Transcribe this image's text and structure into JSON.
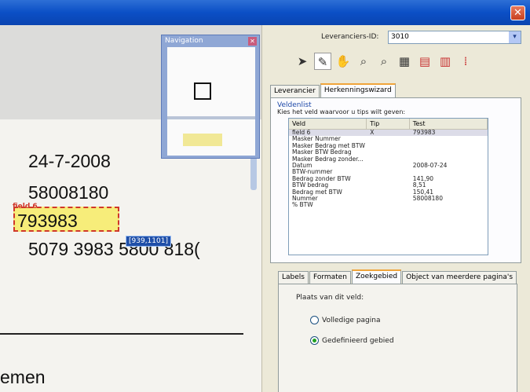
{
  "window": {
    "close_glyph": "✕"
  },
  "document": {
    "lines": [
      "24-7-2008",
      "58008180",
      "793983",
      "5079 3983 5800 818(",
      "emen"
    ],
    "field_label": "field 6",
    "coord_tag": "[939,1101]"
  },
  "navigation": {
    "title": "Navigation",
    "close_glyph": "✕"
  },
  "panel": {
    "leverancier_label": "Leveranciers-ID:",
    "leverancier_value": "3010",
    "toolbar_icons": [
      "pointer-icon",
      "pen-icon",
      "hand-icon",
      "zoom-in-icon",
      "zoom-out-icon",
      "scan-icon",
      "document-red-icon",
      "document-edit-icon",
      "grid-icon"
    ],
    "tabs": [
      "Leverancier",
      "Herkenningswizard"
    ],
    "veldenlist_title": "Veldenlist",
    "veldenlist_sub": "Kies het veld waarvoor u tips wilt geven:",
    "list_headers": [
      "Veld",
      "Tip",
      "Test"
    ],
    "list_rows": [
      [
        "field 6",
        "X",
        "793983"
      ],
      [
        "Masker Nummer",
        "",
        ""
      ],
      [
        "Masker Bedrag met BTW",
        "",
        ""
      ],
      [
        "Masker BTW Bedrag",
        "",
        ""
      ],
      [
        "Masker Bedrag zonder...",
        "",
        ""
      ],
      [
        "Datum",
        "",
        "2008-07-24"
      ],
      [
        "BTW-nummer",
        "",
        ""
      ],
      [
        "Bedrag zonder BTW",
        "",
        "141,90"
      ],
      [
        "BTW bedrag",
        "",
        "8,51"
      ],
      [
        "Bedrag met BTW",
        "",
        "150,41"
      ],
      [
        "Nummer",
        "",
        "58008180"
      ],
      [
        "% BTW",
        "",
        ""
      ]
    ],
    "tabs2": [
      "Labels",
      "Formaten",
      "Zoekgebied",
      "Object van meerdere pagina's"
    ],
    "plaats_label": "Plaats van dit veld:",
    "radio_options": [
      "Volledige pagina",
      "Gedefinieerd gebied"
    ],
    "selected_radio": "Gedefinieerd gebied"
  }
}
